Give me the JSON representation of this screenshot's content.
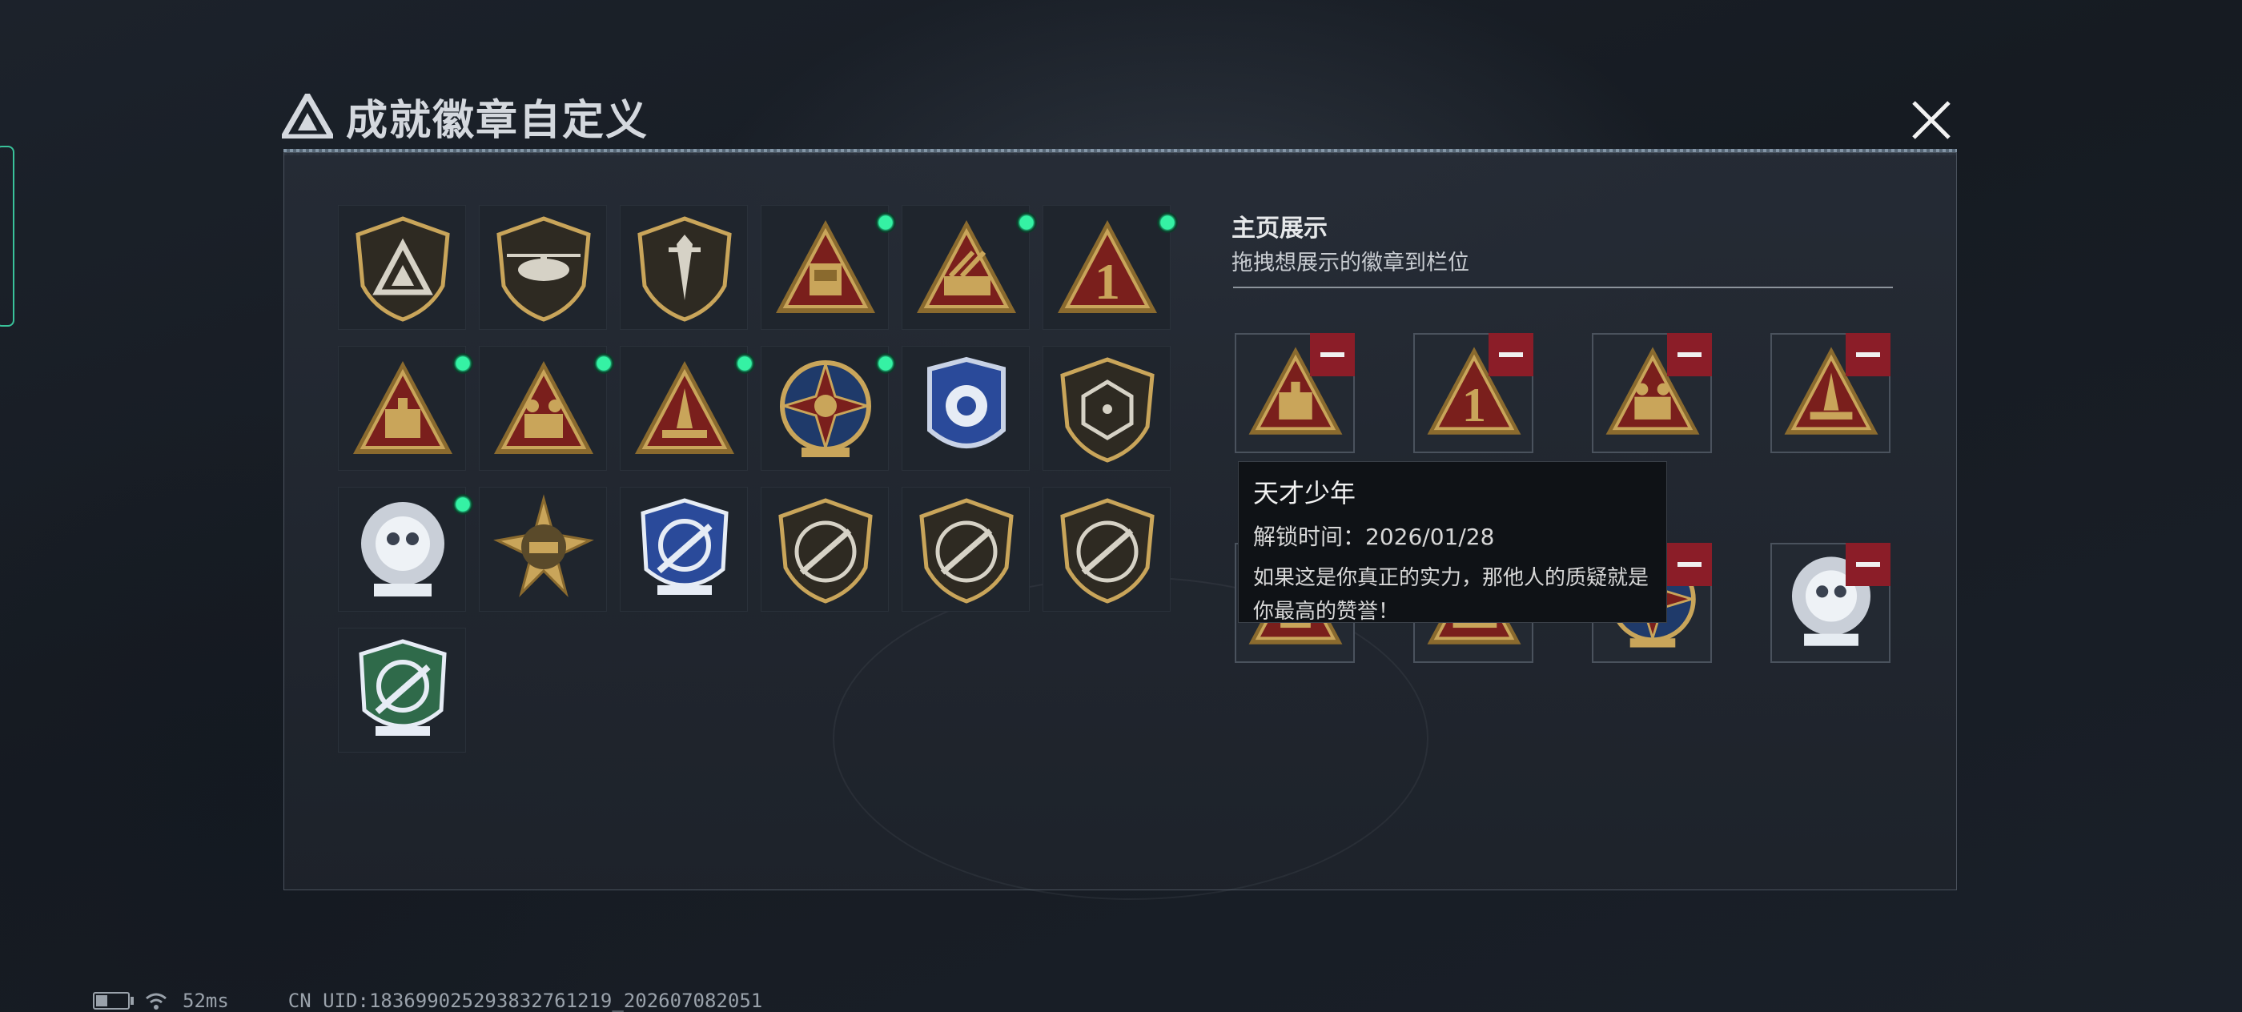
{
  "header": {
    "title": "成就徽章自定义",
    "logo_icon": "triangle-a-logo-icon",
    "close_icon": "close-x-icon"
  },
  "colors": {
    "accent_green": "#35f2a4",
    "remove_red": "#8b1d28",
    "gold": "#c9a55a"
  },
  "badges": [
    {
      "name": "shield-a-badge-icon",
      "new": false
    },
    {
      "name": "helicopter-shield-badge-icon",
      "new": false
    },
    {
      "name": "dagger-shield-badge-icon",
      "new": false
    },
    {
      "name": "box-58-triangle-badge-icon",
      "new": true
    },
    {
      "name": "rocket-launcher-triangle-badge-icon",
      "new": true
    },
    {
      "name": "number-1-triangle-badge-icon",
      "new": true
    },
    {
      "name": "crate-triangle-badge-icon",
      "new": true
    },
    {
      "name": "soldiers-triangle-badge-icon",
      "new": true
    },
    {
      "name": "missile-triangle-badge-icon",
      "new": true
    },
    {
      "name": "star-compass-badge-icon",
      "new": true
    },
    {
      "name": "blue-police-badge-icon",
      "new": false
    },
    {
      "name": "dice-shield-badge-icon",
      "new": false
    },
    {
      "name": "skull-wreath-badge-icon",
      "new": true
    },
    {
      "name": "tank-star-badge-icon",
      "new": false
    },
    {
      "name": "crosshair-rifle-blue-badge-icon",
      "new": false
    },
    {
      "name": "rifle-shield-badge-icon",
      "new": false
    },
    {
      "name": "rifle-shield-badge-icon",
      "new": false
    },
    {
      "name": "rifle-shield-badge-icon",
      "new": false
    },
    {
      "name": "crosshair-knife-green-badge-icon",
      "new": false
    }
  ],
  "display": {
    "title": "主页展示",
    "subtitle": "拖拽想展示的徽章到栏位",
    "slots": [
      {
        "name": "crate-triangle-badge-icon"
      },
      {
        "name": "number-1-triangle-badge-icon"
      },
      {
        "name": "soldiers-triangle-badge-icon"
      },
      {
        "name": "missile-triangle-badge-icon"
      },
      {
        "name": "box-58-triangle-badge-icon"
      },
      {
        "name": "rocket-launcher-triangle-badge-icon"
      },
      {
        "name": "star-compass-badge-icon"
      },
      {
        "name": "skull-wreath-badge-icon"
      }
    ],
    "remove_icon": "minus-icon"
  },
  "tooltip": {
    "name": "天才少年",
    "unlock": "解锁时间：2026/01/28",
    "desc": "如果这是你真正的实力，那他人的质疑就是你最高的赞誉！"
  },
  "status": {
    "ping": "52ms",
    "uid": "CN UID:183699025293832761219_202607082051"
  }
}
